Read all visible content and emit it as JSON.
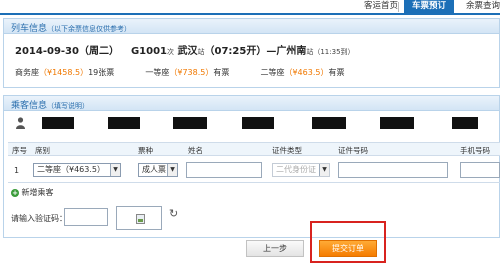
{
  "nav": {
    "home": "客运首页",
    "ticket": "车票预订",
    "remain": "余票查询"
  },
  "train_section": {
    "title": "列车信息",
    "note": "（以下余票信息仅供参考）",
    "date": "2014-09-30",
    "weekday": "（周二）",
    "train_no": "G1001",
    "train_suffix": "次",
    "from_station": "武汉",
    "from_suffix": "站",
    "depart": "（07:25开）",
    "dash": "—",
    "to_station": "广州南",
    "to_suffix": "站",
    "duration": "（11:35到）",
    "seats": [
      {
        "name": "商务座",
        "price": "（¥1458.5）",
        "stock": "19张票"
      },
      {
        "name": "一等座",
        "price": "（¥738.5）",
        "stock": "有票"
      },
      {
        "name": "二等座",
        "price": "（¥463.5）",
        "stock": "有票"
      }
    ]
  },
  "passenger_section": {
    "title": "乘客信息",
    "note": "（填写说明）",
    "columns": {
      "index": "序号",
      "seat": "席别",
      "ticket_type": "票种",
      "name": "姓名",
      "id_type": "证件类型",
      "id_no": "证件号码",
      "phone": "手机号码"
    },
    "row": {
      "index": "1",
      "seat_value": "二等座（¥463.5）",
      "ticket_type_value": "成人票",
      "id_type_value": "二代身份证"
    },
    "add_passenger": "新增乘客",
    "captcha_label": "请输入验证码："
  },
  "buttons": {
    "prev": "上一步",
    "submit": "提交订单"
  },
  "colors": {
    "accent_blue": "#1c6fb7",
    "price_orange": "#f07800",
    "submit_orange": "#f57c00",
    "highlight_red": "#d8231f"
  }
}
